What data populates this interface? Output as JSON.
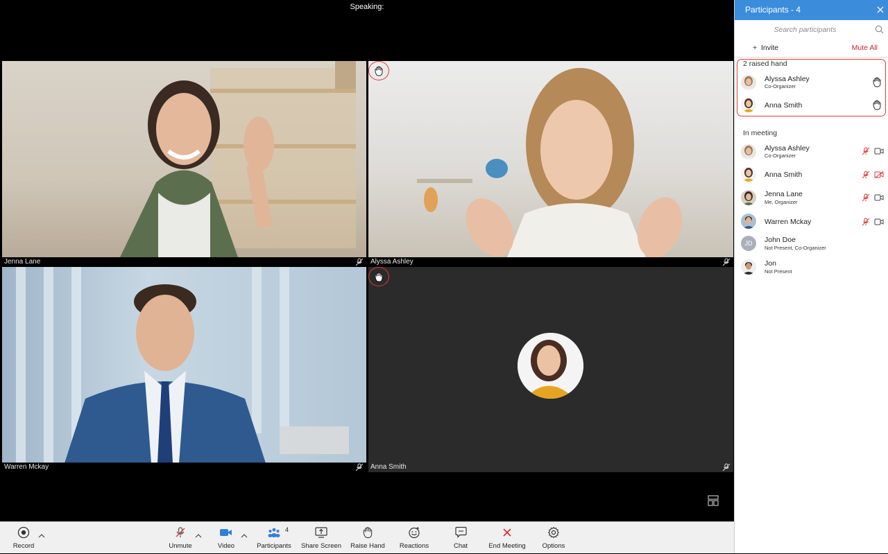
{
  "stage": {
    "speaking_label": "Speaking:",
    "tiles": [
      {
        "name": "Jenna Lane",
        "raised_hand": false,
        "muted": true
      },
      {
        "name": "Alyssa Ashley",
        "raised_hand": true,
        "muted": true
      },
      {
        "name": "Warren Mckay",
        "raised_hand": false,
        "muted": true
      },
      {
        "name": "Anna Smith",
        "raised_hand": true,
        "muted": true,
        "video_off": true
      }
    ]
  },
  "toolbar": {
    "record": "Record",
    "unmute": "Unmute",
    "video": "Video",
    "participants": "Participants",
    "participants_count": "4",
    "share_screen": "Share Screen",
    "raise_hand": "Raise Hand",
    "reactions": "Reactions",
    "chat": "Chat",
    "end_meeting": "End Meeting",
    "options": "Options"
  },
  "panel": {
    "title": "Participants - 4",
    "search_placeholder": "Search participants",
    "invite": "Invite",
    "invite_prefix": "+",
    "mute_all": "Mute All",
    "raised_title": "2 raised hand",
    "raised": [
      {
        "name": "Alyssa Ashley",
        "role": "Co-Organizer"
      },
      {
        "name": "Anna Smith",
        "role": ""
      }
    ],
    "in_meeting_title": "In meeting",
    "in_meeting": [
      {
        "name": "Alyssa Ashley",
        "role": "Co-Organizer",
        "video": "on"
      },
      {
        "name": "Anna Smith",
        "role": "",
        "video": "off"
      },
      {
        "name": "Jenna Lane",
        "role": "Me, Organizer",
        "video": "on"
      },
      {
        "name": "Warren Mckay",
        "role": "",
        "video": "on"
      },
      {
        "name": "John Doe",
        "role": "Not Present, Co-Organizer",
        "initials": "JD"
      },
      {
        "name": "Jon",
        "role": "Not Present"
      }
    ]
  },
  "colors": {
    "accent": "#3b8ddb",
    "danger": "#e23a35",
    "mute_all": "#c8232c",
    "end_meeting": "#e0282e"
  }
}
